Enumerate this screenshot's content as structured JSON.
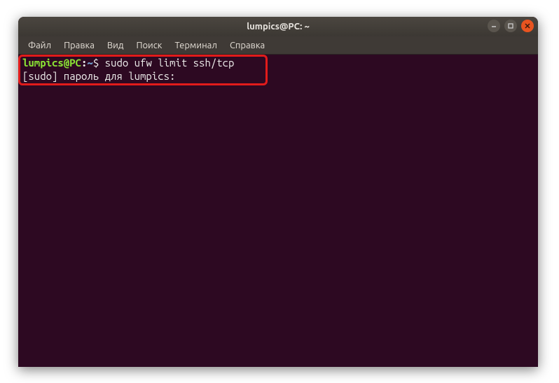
{
  "window": {
    "title": "lumpics@PC: ~"
  },
  "menu": {
    "items": [
      "Файл",
      "Правка",
      "Вид",
      "Поиск",
      "Терминал",
      "Справка"
    ]
  },
  "terminal": {
    "prompt_user_host": "lumpics@PC",
    "prompt_colon": ":",
    "prompt_path": "~",
    "prompt_dollar": "$ ",
    "command": "sudo ufw limit ssh/tcp",
    "line2": "[sudo] пароль для lumpics: "
  },
  "controls": {
    "min": "–",
    "max": "□",
    "close": "×"
  }
}
